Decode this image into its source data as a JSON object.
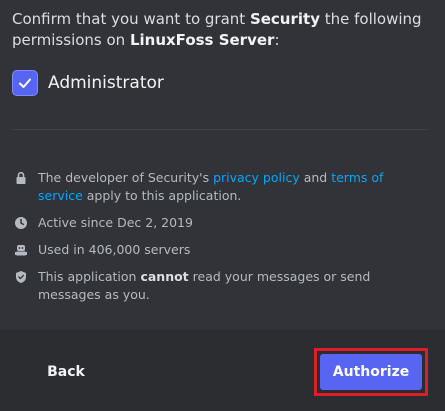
{
  "confirm": {
    "prefix": "Confirm that you want to grant ",
    "app_name": "Security",
    "middle": " the following permissions on ",
    "server_name": "LinuxFoss Server",
    "suffix": ":"
  },
  "permissions": [
    {
      "label": "Administrator",
      "checked": true
    }
  ],
  "info": {
    "policy": {
      "icon": "lock-icon",
      "prefix": "The developer of Security's ",
      "privacy_link": "privacy policy",
      "and": " and ",
      "terms_link": "terms of service",
      "suffix": " apply to this application."
    },
    "active": {
      "icon": "clock-icon",
      "text": "Active since Dec 2, 2019"
    },
    "servers": {
      "icon": "robot-icon",
      "text": "Used in 406,000 servers"
    },
    "privacy": {
      "icon": "shield-icon",
      "prefix": "This application ",
      "emphasis": "cannot",
      "suffix": " read your messages or send messages as you."
    }
  },
  "footer": {
    "back_label": "Back",
    "authorize_label": "Authorize"
  },
  "colors": {
    "accent": "#5865f2",
    "link": "#00a8fc",
    "highlight_border": "#e01e2a"
  }
}
